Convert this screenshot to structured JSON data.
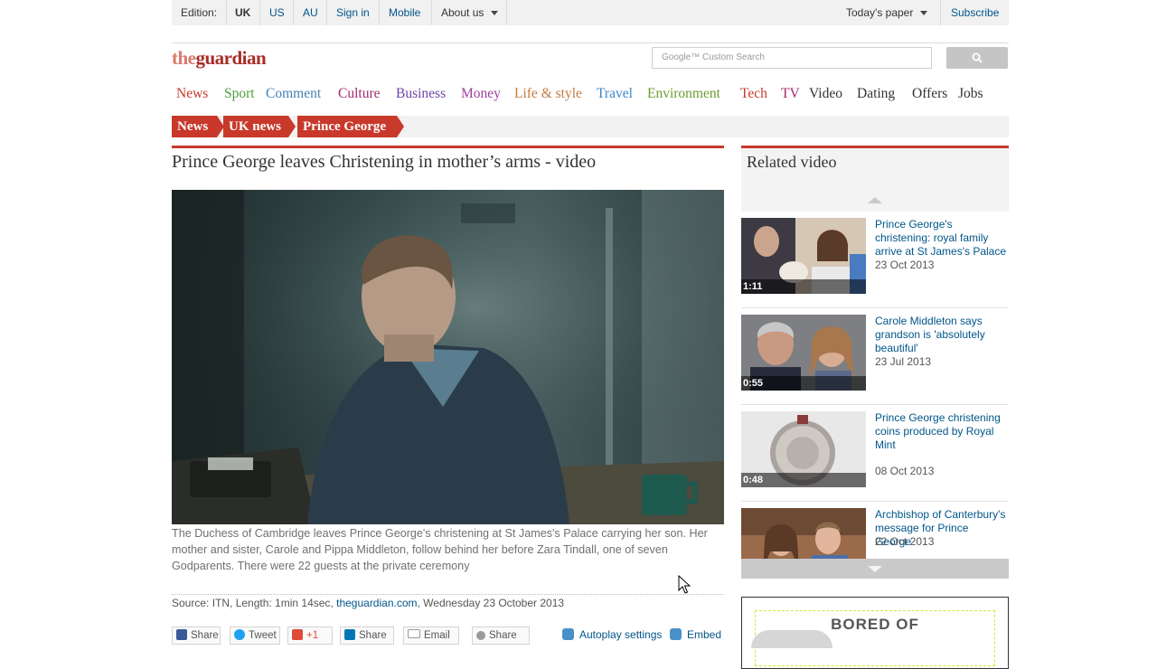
{
  "topbar": {
    "edition_label": "Edition:",
    "editions": [
      "UK",
      "US",
      "AU"
    ],
    "sign_in": "Sign in",
    "mobile": "Mobile",
    "about_us": "About us",
    "todays_paper": "Today's paper",
    "subscribe": "Subscribe"
  },
  "logo": {
    "prefix": "the",
    "name": "guardian"
  },
  "search": {
    "placeholder": "Google™ Custom Search"
  },
  "nav": {
    "items": [
      {
        "label": "News",
        "color": "#c8392b"
      },
      {
        "label": "Sport",
        "color": "#4a9d3a"
      },
      {
        "label": "Comment",
        "color": "#4682b4"
      },
      {
        "label": "Culture",
        "color": "#a5286e"
      },
      {
        "label": "Business",
        "color": "#6b46a6"
      },
      {
        "label": "Money",
        "color": "#9b3fa0"
      },
      {
        "label": "Life & style",
        "color": "#c57a3c"
      },
      {
        "label": "Travel",
        "color": "#3b86c4"
      },
      {
        "label": "Environment",
        "color": "#6b9d30"
      },
      {
        "label": "Tech",
        "color": "#c8392b"
      },
      {
        "label": "TV",
        "color": "#a5286e"
      },
      {
        "label": "Video",
        "color": "#333333"
      },
      {
        "label": "Dating",
        "color": "#333333"
      },
      {
        "label": "Offers",
        "color": "#333333"
      },
      {
        "label": "Jobs",
        "color": "#333333"
      }
    ]
  },
  "breadcrumb": [
    "News",
    "UK news",
    "Prince George"
  ],
  "article": {
    "headline": "Prince George leaves Christening in mother’s arms - video",
    "caption": "The Duchess of Cambridge leaves Prince George's christening at St James's Palace carrying her son. Her mother and sister, Carole and Pippa Middleton, follow behind her before Zara Tindall, one of seven Godparents. There were 22 guests at the private ceremony",
    "source_prefix": "Source: ITN, Length: 1min 14sec,",
    "source_link": "theguardian.com",
    "source_date": ", Wednesday 23 October 2013"
  },
  "share": {
    "facebook": "Share",
    "twitter": "Tweet",
    "gplus": "+1",
    "linkedin": "Share",
    "email": "Email",
    "share": "Share",
    "autoplay": "Autoplay settings",
    "embed": "Embed"
  },
  "related": {
    "title": "Related video",
    "items": [
      {
        "title": "Prince George's christening: royal family arrive at St James's Palace",
        "date": "23 Oct 2013",
        "duration": "1:11"
      },
      {
        "title": "Carole Middleton says grandson is 'absolutely beautiful'",
        "date": "23 Jul 2013",
        "duration": "0:55"
      },
      {
        "title": "Prince George christening coins produced by Royal Mint",
        "date": "08 Oct 2013",
        "duration": "0:48"
      },
      {
        "title": "Archbishop of Canterbury's message for Prince George",
        "date": "22 Oct 2013",
        "duration": ""
      }
    ]
  },
  "ad": {
    "text": "BORED OF"
  }
}
